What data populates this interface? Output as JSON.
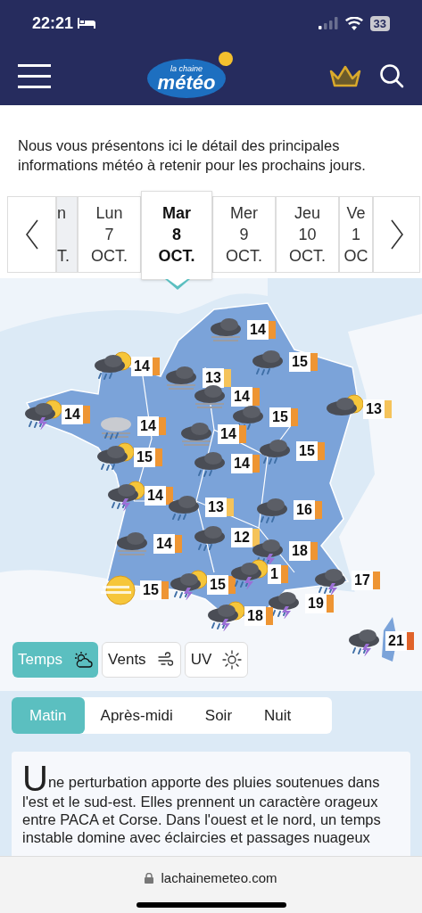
{
  "status_bar": {
    "time": "22:21",
    "battery": "33"
  },
  "header": {
    "logo": {
      "line1": "la chaine",
      "line2": "météo"
    }
  },
  "intro": "Nous vous présentons ici le détail des principales informations météo à retenir pour les prochains jours.",
  "days": [
    {
      "day": "n",
      "month": "T.",
      "selected": false
    },
    {
      "day": "Lun",
      "date": "7",
      "month": "OCT.",
      "selected": false
    },
    {
      "day": "Mar",
      "date": "8",
      "month": "OCT.",
      "selected": true
    },
    {
      "day": "Mer",
      "date": "9",
      "month": "OCT.",
      "selected": false
    },
    {
      "day": "Jeu",
      "date": "10",
      "month": "OCT.",
      "selected": false
    },
    {
      "day": "Ve",
      "date": "1",
      "month": "OC",
      "selected": false
    }
  ],
  "map": {
    "markers": [
      {
        "temp": "14",
        "kind": "fog",
        "color": "#ee9533"
      },
      {
        "temp": "14",
        "kind": "sun-rain",
        "color": "#ee9533"
      },
      {
        "temp": "13",
        "kind": "fog",
        "color": "#f5c35a"
      },
      {
        "temp": "15",
        "kind": "rain",
        "color": "#ee9533"
      },
      {
        "temp": "14",
        "kind": "sun-storm",
        "color": "#ee9533"
      },
      {
        "temp": "14",
        "kind": "fog-rain",
        "color": "#ee9533"
      },
      {
        "temp": "14",
        "kind": "fog",
        "color": "#ee9533"
      },
      {
        "temp": "15",
        "kind": "rain",
        "color": "#ee9533"
      },
      {
        "temp": "13",
        "kind": "sun-cloud",
        "color": "#f5c35a"
      },
      {
        "temp": "14",
        "kind": "fog",
        "color": "#ee9533"
      },
      {
        "temp": "15",
        "kind": "sun-rain",
        "color": "#ee9533"
      },
      {
        "temp": "14",
        "kind": "rain",
        "color": "#ee9533"
      },
      {
        "temp": "15",
        "kind": "rain",
        "color": "#ee9533"
      },
      {
        "temp": "14",
        "kind": "sun-storm",
        "color": "#ee9533"
      },
      {
        "temp": "13",
        "kind": "rain",
        "color": "#f5c35a"
      },
      {
        "temp": "16",
        "kind": "rain",
        "color": "#ee9533"
      },
      {
        "temp": "14",
        "kind": "fog",
        "color": "#ee9533"
      },
      {
        "temp": "12",
        "kind": "rain",
        "color": "#f5c35a"
      },
      {
        "temp": "18",
        "kind": "storm",
        "color": "#ee9533"
      },
      {
        "temp": "15",
        "kind": "sun",
        "color": "#ee9533"
      },
      {
        "temp": "15",
        "kind": "sun-storm",
        "color": "#ee9533"
      },
      {
        "temp": "1",
        "kind": "sun-storm",
        "color": "#ee9533"
      },
      {
        "temp": "19",
        "kind": "storm",
        "color": "#ee9533"
      },
      {
        "temp": "17",
        "kind": "storm",
        "color": "#ee9533"
      },
      {
        "temp": "18",
        "kind": "sun-storm",
        "color": "#ee9533"
      },
      {
        "temp": "21",
        "kind": "storm",
        "color": "#e0632a"
      }
    ]
  },
  "layers": [
    {
      "label": "Temps",
      "selected": true
    },
    {
      "label": "Vents",
      "selected": false
    },
    {
      "label": "UV",
      "selected": false
    }
  ],
  "periods": [
    {
      "label": "Matin",
      "selected": true
    },
    {
      "label": "Après-midi",
      "selected": false
    },
    {
      "label": "Soir",
      "selected": false
    },
    {
      "label": "Nuit",
      "selected": false
    }
  ],
  "summary": {
    "initial": "U",
    "text": "ne perturbation apporte des pluies soutenues dans l'est et le sud-est. Elles prennent un caractère orageux entre PACA et Corse. Dans l'ouest et le nord, un temps instable domine avec éclaircies et passages nuageux"
  },
  "browser": {
    "url": "lachainemeteo.com"
  }
}
